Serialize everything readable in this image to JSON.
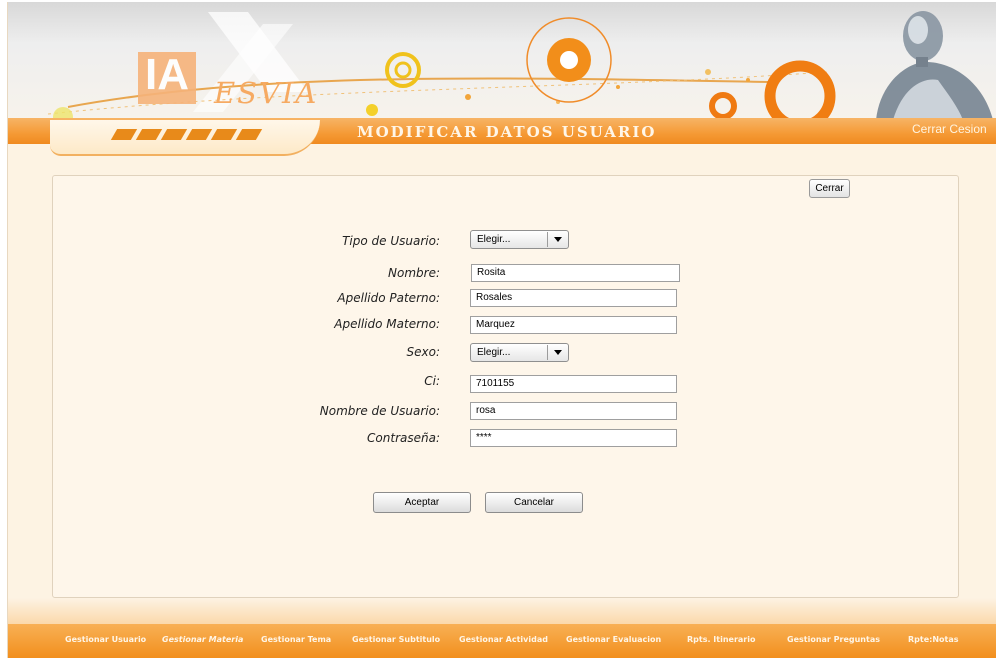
{
  "header": {
    "logo_main": "IA",
    "logo_sub": "ESVIA",
    "page_title": "MODIFICAR DATOS USUARIO",
    "logout_label": "Cerrar Cesion"
  },
  "panel": {
    "close_label": "Cerrar",
    "form": {
      "tipo_usuario": {
        "label": "Tipo de Usuario:",
        "value": "Elegir..."
      },
      "nombre": {
        "label": "Nombre:",
        "value": "Rosita"
      },
      "apellido_paterno": {
        "label": "Apellido Paterno:",
        "value": "Rosales"
      },
      "apellido_materno": {
        "label": "Apellido Materno:",
        "value": "Marquez"
      },
      "sexo": {
        "label": "Sexo:",
        "value": "Elegir..."
      },
      "ci": {
        "label": "Ci:",
        "value": "7101155"
      },
      "nombre_usuario": {
        "label": "Nombre de Usuario:",
        "value": "rosa"
      },
      "contrasena": {
        "label": "Contraseña:",
        "value": "****"
      }
    },
    "accept_label": "Aceptar",
    "cancel_label": "Cancelar"
  },
  "footer_nav": [
    {
      "label": "Gestionar Usuario"
    },
    {
      "label": "Gestionar Materia"
    },
    {
      "label": "Gestionar Tema"
    },
    {
      "label": "Gestionar Subtitulo"
    },
    {
      "label": "Gestionar Actividad"
    },
    {
      "label": "Gestionar Evaluacion"
    },
    {
      "label": "Rpts. Itinerario"
    },
    {
      "label": "Gestionar Preguntas"
    },
    {
      "label": "Rpte:Notas"
    }
  ],
  "colors": {
    "accent_orange": "#f5962a",
    "panel_background": "#fef6ea",
    "page_background": "#fdf3e3"
  },
  "icons": {
    "dropdown": "caret-down-icon",
    "decoration": "orange-rings",
    "mascot": "robot-figure"
  }
}
